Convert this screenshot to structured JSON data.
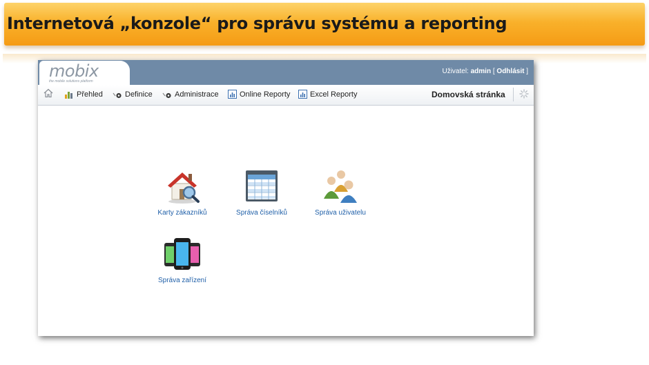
{
  "slide": {
    "title": "Internetová „konzole“ pro správu systému a reporting"
  },
  "app": {
    "logo": "mobix",
    "tagline": "the mobile solutions platform",
    "user_label": "Uživatel:",
    "user_name": "admin",
    "logout_label": "Odhlásit",
    "bracket_open": "[",
    "bracket_close": "]"
  },
  "nav": {
    "items": [
      {
        "label": "Přehled",
        "icon": "bar-chart-icon"
      },
      {
        "label": "Definice",
        "icon": "gear-icon"
      },
      {
        "label": "Administrace",
        "icon": "gear-icon"
      },
      {
        "label": "Online Reporty",
        "icon": "report-icon"
      },
      {
        "label": "Excel Reporty",
        "icon": "report-icon"
      }
    ],
    "current_page": "Domovská stránka"
  },
  "tiles": [
    {
      "label": "Karty zákazníků",
      "icon": "house-search-icon"
    },
    {
      "label": "Správa číselníků",
      "icon": "table-icon"
    },
    {
      "label": "Správa uživatelu",
      "icon": "users-icon"
    },
    {
      "label": "Správa zařízení",
      "icon": "phones-icon"
    }
  ]
}
